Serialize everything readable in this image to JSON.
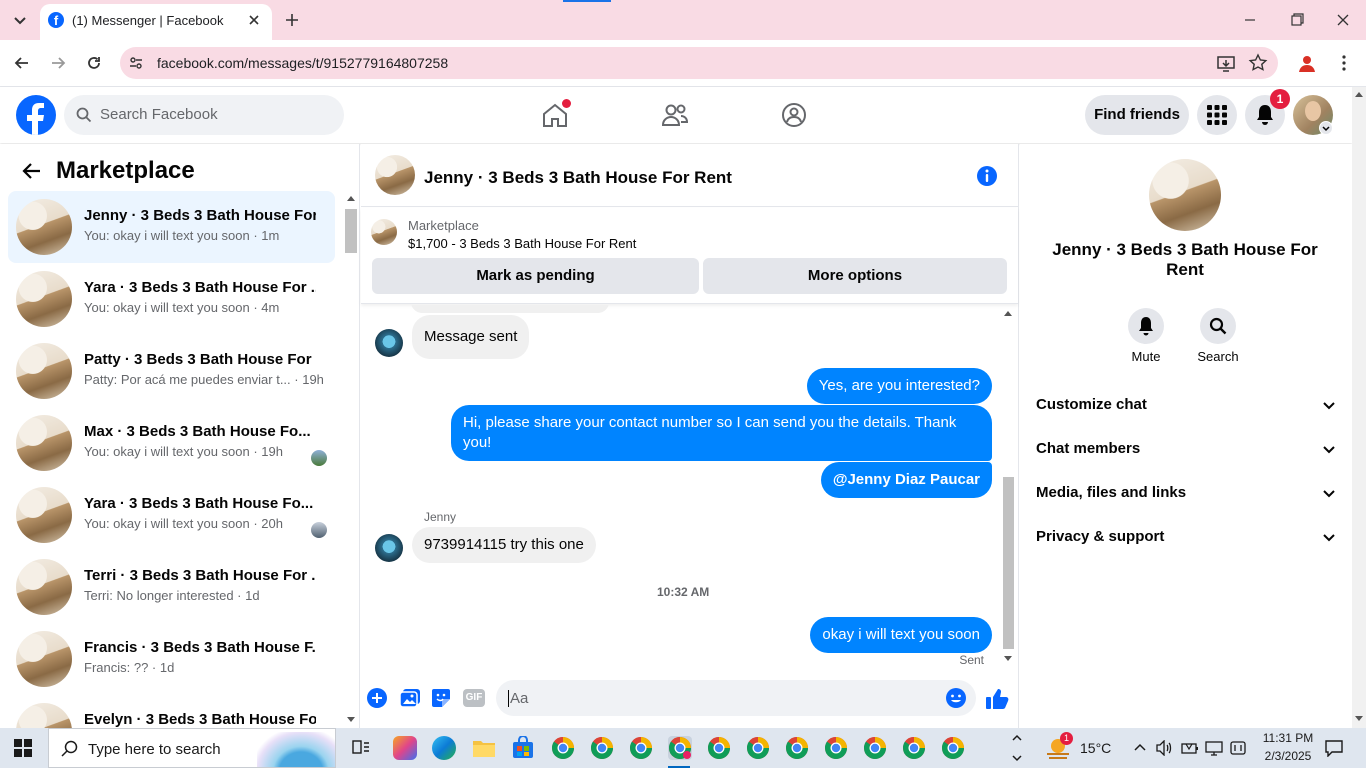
{
  "browser": {
    "tab_title": "(1) Messenger | Facebook",
    "url": "facebook.com/messages/t/9152779164807258"
  },
  "fb_header": {
    "search_placeholder": "Search Facebook",
    "find_friends": "Find friends",
    "notification_count": "1"
  },
  "sidebar": {
    "title": "Marketplace",
    "conversations": [
      {
        "name": "Jenny · 3 Beds 3 Bath House For...",
        "preview": "You: okay i will text you soon · 1m",
        "active": true
      },
      {
        "name": "Yara · 3 Beds 3 Bath House For ...",
        "preview": "You: okay i will text you soon · 4m"
      },
      {
        "name": "Patty · 3 Beds 3 Bath House For ...",
        "preview": "Patty: Por acá me puedes enviar t... · 19h"
      },
      {
        "name": "Max · 3 Beds 3 Bath House Fo...",
        "preview": "You: okay i will text you soon · 19h"
      },
      {
        "name": "Yara · 3 Beds 3 Bath House Fo...",
        "preview": "You: okay i will text you soon · 20h"
      },
      {
        "name": "Terri · 3 Beds 3 Bath House For ...",
        "preview": "Terri: No longer interested · 1d"
      },
      {
        "name": "Francis · 3 Beds 3 Bath House F...",
        "preview": "Francis: ?? · 1d"
      },
      {
        "name": "Evelyn · 3 Beds 3 Bath House Fo...",
        "preview": ""
      }
    ]
  },
  "chat": {
    "title": "Jenny · 3 Beds 3 Bath House For Rent",
    "listing_label": "Marketplace",
    "listing_title": "$1,700 - 3 Beds 3 Bath House For Rent",
    "mark_pending": "Mark as pending",
    "more_options": "More options",
    "messages": {
      "m1": "Message sent",
      "m2": "Yes, are you interested?",
      "m3": "Hi, please share your contact number so I can send you the details. Thank you!",
      "m4": "@Jenny Diaz Paucar",
      "sender": "Jenny",
      "m5": "9739914115 try this one",
      "time": "10:32 AM",
      "m6": "okay i will text you soon",
      "status": "Sent"
    },
    "composer_placeholder": "Aa"
  },
  "info_panel": {
    "name": "Jenny · 3 Beds 3 Bath House For Rent",
    "mute": "Mute",
    "search": "Search",
    "sections": [
      "Customize chat",
      "Chat members",
      "Media, files and links",
      "Privacy & support"
    ]
  },
  "taskbar": {
    "search_placeholder": "Type here to search",
    "weather": "15°C",
    "weather_badge": "1",
    "time": "11:31 PM",
    "date": "2/3/2025"
  },
  "colors": {
    "accent": "#0084ff",
    "fb_blue": "#0866ff",
    "notif_red": "#e41e3f",
    "tab_bg": "#f9dbe4"
  }
}
